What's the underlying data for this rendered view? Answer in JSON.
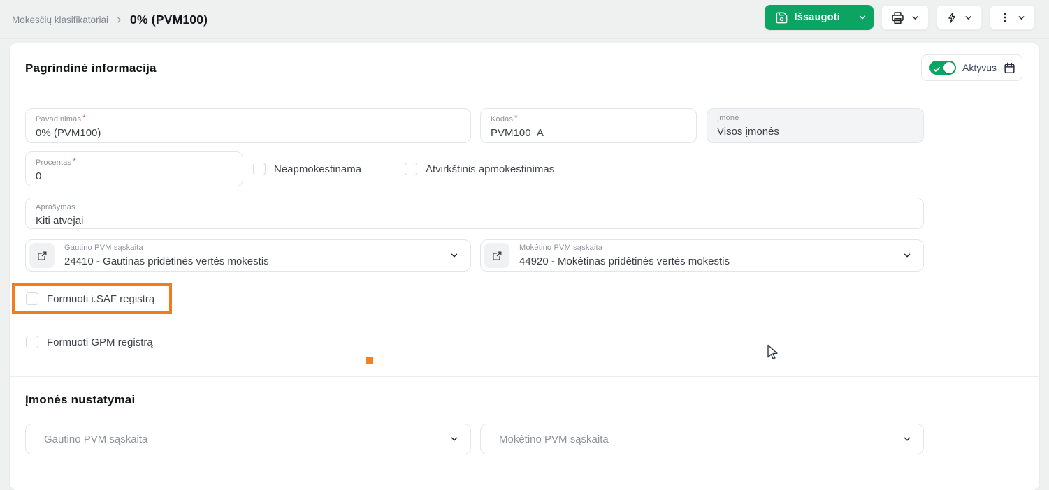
{
  "breadcrumb": {
    "parent": "Mokesčių klasifikatoriai",
    "current": "0% (PVM100)"
  },
  "toolbar": {
    "save_label": "Išsaugoti"
  },
  "main_section": {
    "title": "Pagrindinė informacija",
    "active_toggle": {
      "label": "Aktyvus",
      "state": "on"
    },
    "fields": {
      "pavadinimas": {
        "label": "Pavadinimas",
        "required": "*",
        "value": "0% (PVM100)"
      },
      "kodas": {
        "label": "Kodas",
        "required": "*",
        "value": "PVM100_A"
      },
      "imone": {
        "label": "Įmonė",
        "value": "Visos įmonės"
      },
      "procentas": {
        "label": "Procentas",
        "required": "*",
        "value": "0"
      },
      "aprasymas": {
        "label": "Aprašymas",
        "value": "Kiti atvejai"
      }
    },
    "checkboxes": {
      "neapmokestinama": {
        "label": "Neapmokestinama",
        "checked": false
      },
      "atvirkstinis": {
        "label": "Atvirkštinis apmokestinimas",
        "checked": false
      },
      "isaf": {
        "label": "Formuoti i.SAF registrą",
        "checked": false
      },
      "gpm": {
        "label": "Formuoti GPM registrą",
        "checked": false
      }
    },
    "dropdowns": {
      "gautino": {
        "label": "Gautino PVM sąskaita",
        "value": "24410 - Gautinas pridėtinės vertės mokestis"
      },
      "moketino": {
        "label": "Mokėtino PVM sąskaita",
        "value": "44920 - Mokėtinas pridėtinės vertės mokestis"
      }
    }
  },
  "company_section": {
    "title": "Įmonės nustatymai",
    "dropdowns": {
      "gautino_placeholder": "Gautino PVM sąskaita",
      "moketino_placeholder": "Mokėtino PVM sąskaita"
    }
  },
  "colors": {
    "accent_green": "#0ba463",
    "highlight_orange": "#f07c1e"
  }
}
